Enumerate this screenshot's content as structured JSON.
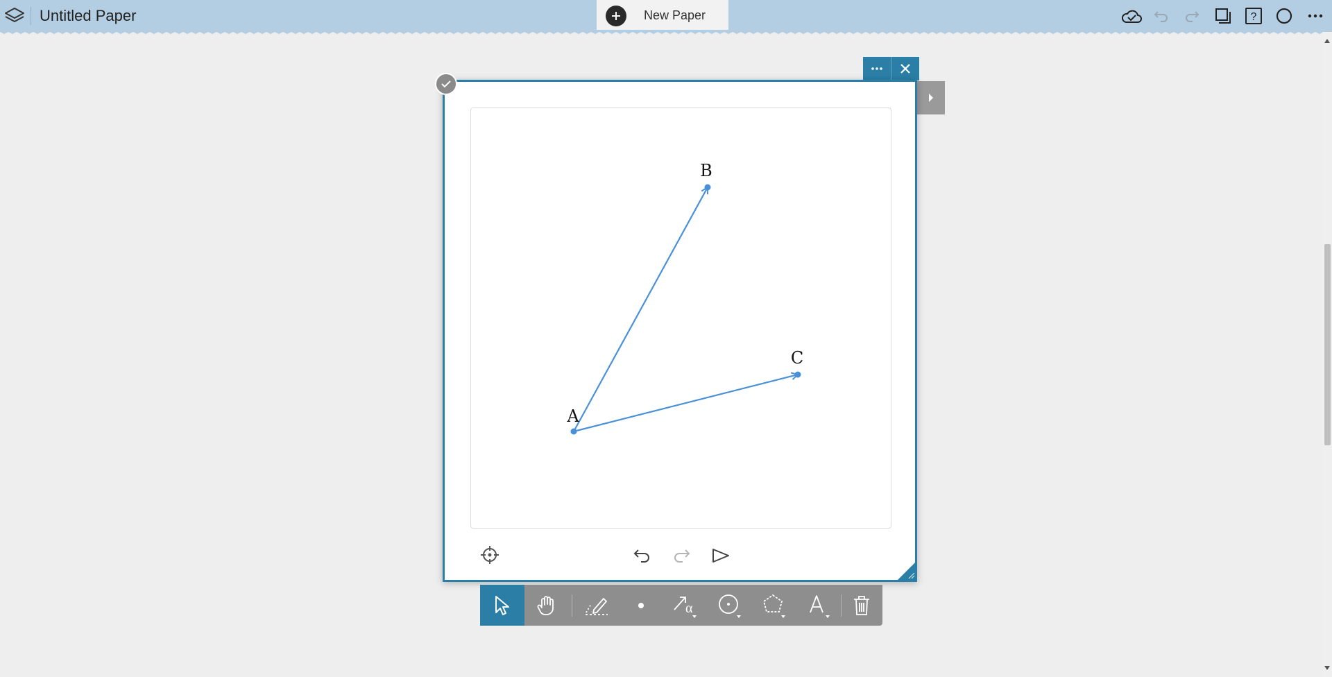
{
  "header": {
    "title": "Untitled Paper",
    "new_paper_label": "New Paper",
    "icons": [
      "layers-icon",
      "cloud-check-icon",
      "undo-icon",
      "redo-icon",
      "pages-icon",
      "help-icon",
      "circle-icon",
      "more-icon"
    ]
  },
  "widget": {
    "points": [
      {
        "label": "A"
      },
      {
        "label": "B"
      },
      {
        "label": "C"
      }
    ],
    "vectors": [
      {
        "from": "A",
        "to": "B"
      },
      {
        "from": "A",
        "to": "C"
      }
    ],
    "bottom_controls": [
      "crosshair-icon",
      "undo-icon",
      "redo-icon",
      "play-icon"
    ]
  },
  "toolbar": {
    "tools": [
      "select",
      "pan",
      "pen",
      "point",
      "vector",
      "circle",
      "polygon",
      "text",
      "delete"
    ],
    "active_tool": "select"
  },
  "colors": {
    "header_bg": "#b3cde3",
    "accent": "#2b7fa6",
    "toolbar_bg": "#8e8e8e",
    "vector_color": "#4a90d9",
    "page_bg": "#eeeeee"
  }
}
